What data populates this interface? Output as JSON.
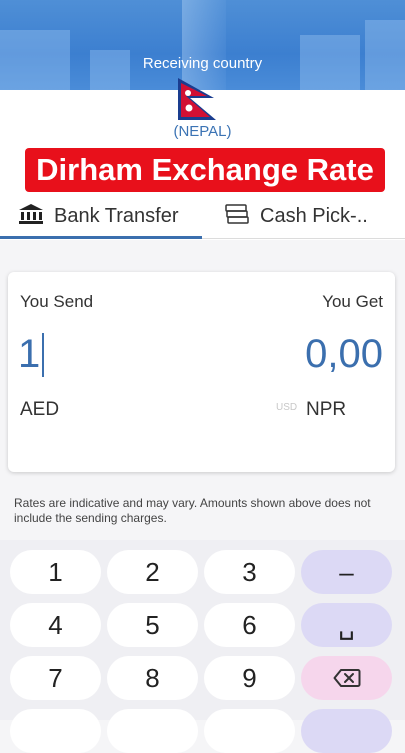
{
  "header": {
    "receiving_label": "Receiving country",
    "country": "(NEPAL)",
    "flag_icon": "nepal-flag"
  },
  "banner": {
    "title": "Dirham Exchange Rate"
  },
  "tabs": [
    {
      "label": "Bank Transfer",
      "icon": "bank-icon",
      "selected": true
    },
    {
      "label": "Cash Pick-..",
      "icon": "cash-icon",
      "selected": false
    }
  ],
  "converter": {
    "send_label": "You Send",
    "get_label": "You Get",
    "send_amount": "1",
    "get_amount": "0,00",
    "send_currency": "AED",
    "get_currency_ghost": "USD",
    "get_currency": "NPR"
  },
  "note": "Rates are indicative and may vary. Amounts shown above does not include the sending charges.",
  "keyboard": {
    "rows": [
      [
        "1",
        "2",
        "3",
        "–"
      ],
      [
        "4",
        "5",
        "6",
        "␣"
      ],
      [
        "7",
        "8",
        "9",
        "⌫"
      ],
      [
        "",
        "",
        "",
        ""
      ]
    ]
  },
  "colors": {
    "accent": "#3b6fae",
    "banner": "#e8101b",
    "header": "#4a8cd8",
    "key_action": "#dcd9f5",
    "key_delete": "#f6d6ec"
  }
}
